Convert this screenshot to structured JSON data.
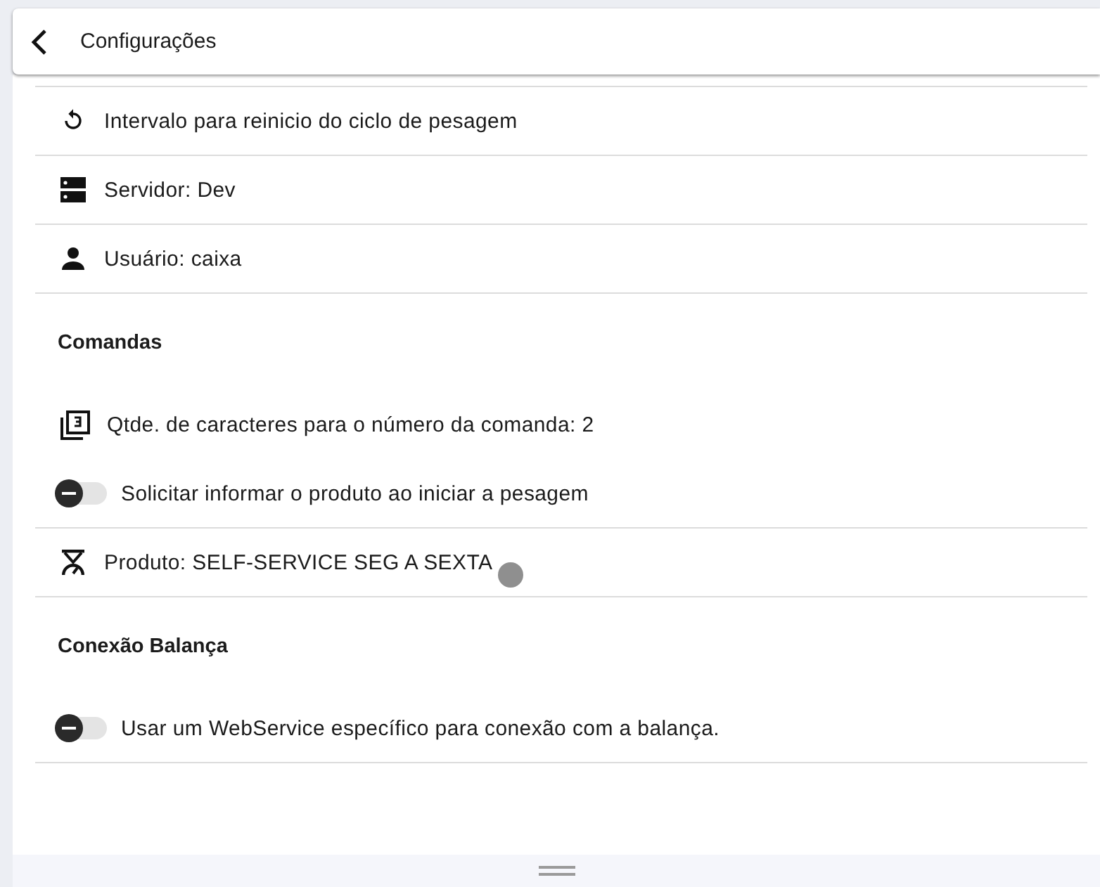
{
  "header": {
    "title": "Configurações"
  },
  "sections": [
    {
      "items": [
        {
          "kind": "reload",
          "label": "Intervalo para reinicio do ciclo de pesagem",
          "divider": true
        },
        {
          "kind": "server",
          "label": "Servidor: Dev",
          "divider": true
        },
        {
          "kind": "user",
          "label": "Usuário: caixa",
          "divider": true
        }
      ]
    },
    {
      "title": "Comandas",
      "items": [
        {
          "kind": "counter",
          "label": "Qtde. de caracteres para o número da comanda: 2",
          "divider": false
        },
        {
          "kind": "toggle",
          "label": "Solicitar informar o produto ao iniciar a pesagem",
          "on": false,
          "divider": true
        },
        {
          "kind": "scale",
          "label": "Produto: SELF-SERVICE SEG A SEXTA",
          "divider": true
        }
      ]
    },
    {
      "title": "Conexão Balança",
      "items": [
        {
          "kind": "toggle",
          "label": "Usar um WebService específico para conexão com a balança.",
          "on": false,
          "divider": true
        }
      ]
    }
  ]
}
